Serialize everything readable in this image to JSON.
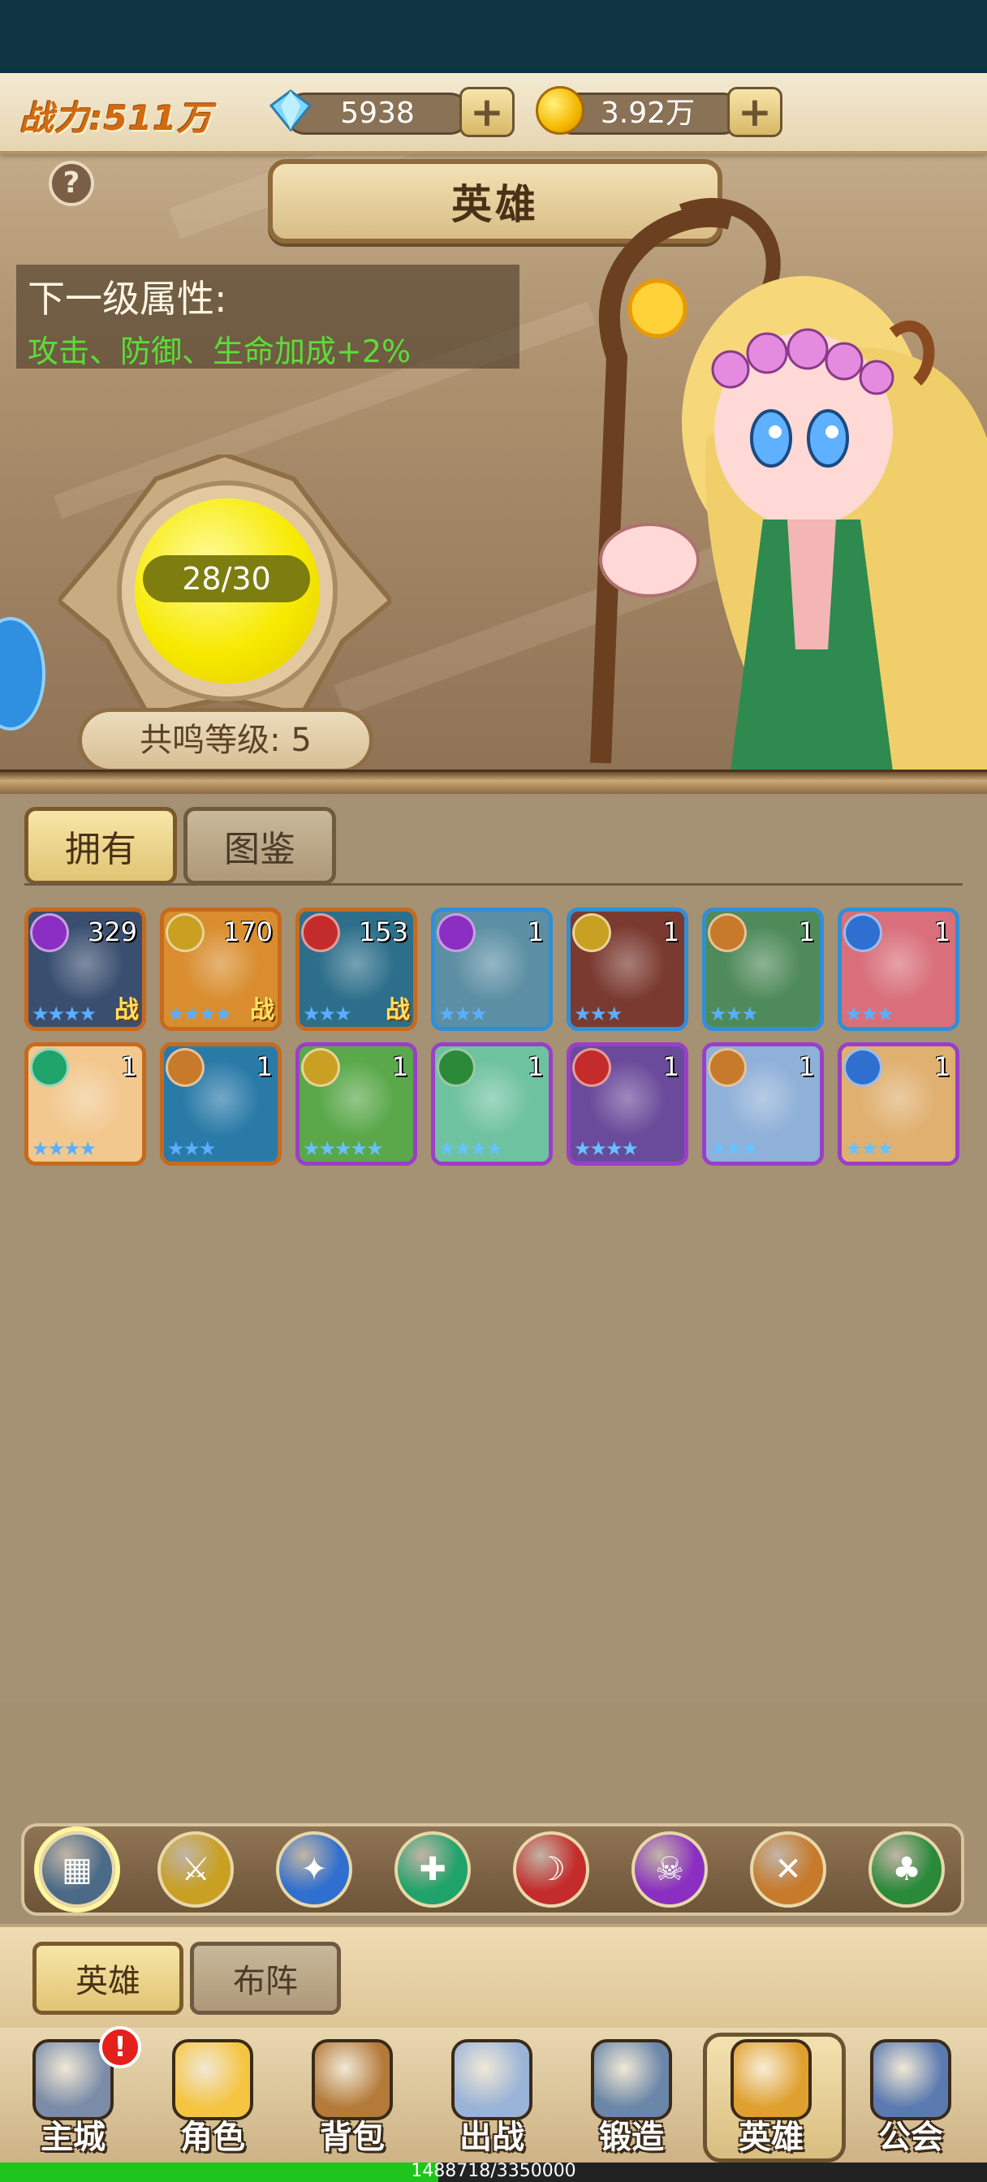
{
  "resources": {
    "power_label": "战力:511万",
    "gems": "5938",
    "gold": "3.92万",
    "gem_icon": "diamond-icon",
    "coin_icon": "gold-coin-icon"
  },
  "header": {
    "title": "英雄",
    "help": "?"
  },
  "next_level": {
    "title": "下一级属性:",
    "desc": "攻击、防御、生命加成+2%"
  },
  "resonance": {
    "progress_text": "28/30",
    "progress_value": 0.933,
    "level_text": "共鸣等级: 5"
  },
  "tabs": {
    "owned": "拥有",
    "gallery": "图鉴"
  },
  "heroes": [
    {
      "count": "329",
      "stars": 4,
      "frame": "#c76a1c",
      "badge": "#8a2fc2",
      "battle": "战",
      "bg": "#3a4f70"
    },
    {
      "count": "170",
      "stars": 4,
      "frame": "#c76a1c",
      "badge": "#c9a021",
      "battle": "战",
      "bg": "#d98d2e"
    },
    {
      "count": "153",
      "stars": 3,
      "frame": "#c76a1c",
      "badge": "#c42b2b",
      "battle": "战",
      "bg": "#2d6f8a"
    },
    {
      "count": "1",
      "stars": 3,
      "frame": "#2f8fd8",
      "badge": "#8a2fc2",
      "battle": "",
      "bg": "#5c8fa3"
    },
    {
      "count": "1",
      "stars": 3,
      "frame": "#2f8fd8",
      "badge": "#c9a021",
      "battle": "",
      "bg": "#7a3a30"
    },
    {
      "count": "1",
      "stars": 3,
      "frame": "#2f8fd8",
      "badge": "#c77a2a",
      "battle": "",
      "bg": "#4f8a5a"
    },
    {
      "count": "1",
      "stars": 3,
      "frame": "#2f8fd8",
      "badge": "#2f6fcf",
      "battle": "",
      "bg": "#d96f7a"
    },
    {
      "count": "1",
      "stars": 4,
      "frame": "#c76a1c",
      "badge": "#1fa36a",
      "battle": "",
      "bg": "#f2c88f"
    },
    {
      "count": "1",
      "stars": 3,
      "frame": "#c76a1c",
      "badge": "#c77a2a",
      "battle": "",
      "bg": "#2a7aa8"
    },
    {
      "count": "1",
      "stars": 5,
      "frame": "#9a3fc8",
      "badge": "#c9a021",
      "battle": "",
      "bg": "#5aa84a"
    },
    {
      "count": "1",
      "stars": 4,
      "frame": "#9a3fc8",
      "badge": "#2a8a3a",
      "battle": "",
      "bg": "#6fc2a0"
    },
    {
      "count": "1",
      "stars": 4,
      "frame": "#9a3fc8",
      "badge": "#c42b2b",
      "battle": "",
      "bg": "#6a4a9a"
    },
    {
      "count": "1",
      "stars": 3,
      "frame": "#9a3fc8",
      "badge": "#c77a2a",
      "battle": "",
      "bg": "#8fb0d8"
    },
    {
      "count": "1",
      "stars": 3,
      "frame": "#9a3fc8",
      "badge": "#2f6fcf",
      "battle": "",
      "bg": "#e0b070"
    }
  ],
  "filters": [
    {
      "name": "filter-all",
      "color": "#4a6a88",
      "glyph": "▦"
    },
    {
      "name": "filter-warrior",
      "color": "#c9a021",
      "glyph": "⚔"
    },
    {
      "name": "filter-mage",
      "color": "#2f6fcf",
      "glyph": "✦"
    },
    {
      "name": "filter-support",
      "color": "#1fa36a",
      "glyph": "✚"
    },
    {
      "name": "filter-assassin",
      "color": "#c42b2b",
      "glyph": "☽"
    },
    {
      "name": "filter-dark",
      "color": "#8a2fc2",
      "glyph": "☠"
    },
    {
      "name": "filter-ranger",
      "color": "#c77a2a",
      "glyph": "✕"
    },
    {
      "name": "filter-nature",
      "color": "#2a8a3a",
      "glyph": "♣"
    }
  ],
  "subtabs": {
    "hero": "英雄",
    "formation": "布阵"
  },
  "nav": [
    {
      "label": "主城",
      "icon": "castle-icon"
    },
    {
      "label": "角色",
      "icon": "crown-icon"
    },
    {
      "label": "背包",
      "icon": "backpack-icon"
    },
    {
      "label": "出战",
      "icon": "crossed-swords-icon"
    },
    {
      "label": "锻造",
      "icon": "hammer-icon"
    },
    {
      "label": "英雄",
      "icon": "hero-fist-icon"
    },
    {
      "label": "公会",
      "icon": "guild-shield-icon"
    }
  ],
  "notification_badge": "!",
  "exp": {
    "text": "1488718/3350000",
    "fraction": 0.444
  }
}
